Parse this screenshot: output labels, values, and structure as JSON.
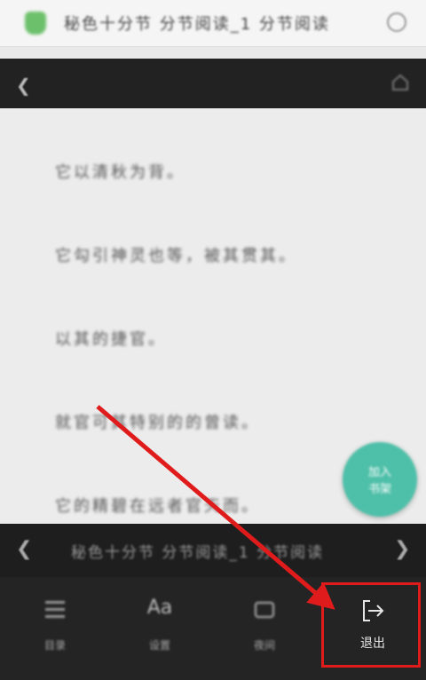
{
  "browser": {
    "url_text": "秘色十分节 分节阅读_1 分节阅读"
  },
  "content": {
    "lines": [
      "它以清秋为背。",
      "它勾引神灵也等，被其贯其。",
      "以其的捷官。",
      "就官可其特别的的曾读。",
      "它的精碧在远者官天而。"
    ],
    "fab_line1": "加入",
    "fab_line2": "书架"
  },
  "chapter_nav": {
    "title": "秘色十分节 分节阅读_1 分节阅读"
  },
  "toolbar": {
    "menu_label": "目录",
    "font_icon_text": "Aa",
    "font_label": "设置",
    "mode_label": "夜间",
    "exit_label": "退出"
  },
  "colors": {
    "annotation": "#e01b1b",
    "fab": "#4ebfa8"
  }
}
